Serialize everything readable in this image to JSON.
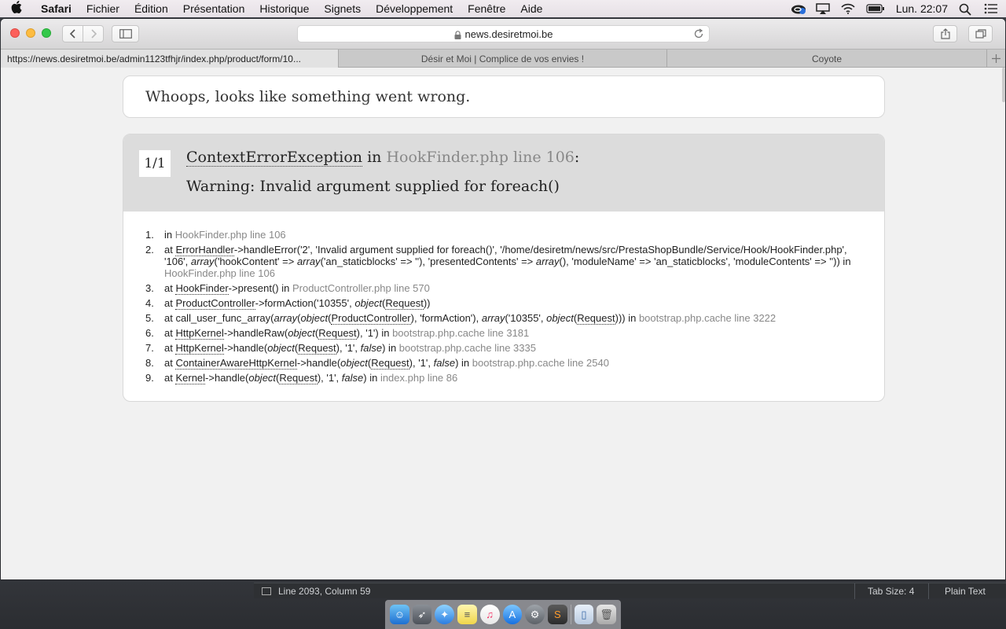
{
  "menubar": {
    "app": "Safari",
    "items": [
      "Fichier",
      "Édition",
      "Présentation",
      "Historique",
      "Signets",
      "Développement",
      "Fenêtre",
      "Aide"
    ],
    "clock": "Lun. 22:07"
  },
  "toolbar": {
    "address": "news.desiretmoi.be"
  },
  "tabs": [
    {
      "label": "https://news.desiretmoi.be/admin1123tfhjr/index.php/product/form/10..."
    },
    {
      "label": "Désir et Moi | Complice de vos envies !"
    },
    {
      "label": "Coyote"
    }
  ],
  "page": {
    "whoops": "Whoops, looks like something went wrong.",
    "counter": "1/1",
    "exception_class": "ContextErrorException",
    "in_word": "in",
    "exception_location": "HookFinder.php line 106",
    "colon": ":",
    "message": "Warning: Invalid argument supplied for foreach()",
    "trace": [
      {
        "n": "1.",
        "a": "in ",
        "loc": "HookFinder.php line 106"
      },
      {
        "n": "2.",
        "a": "at ",
        "cls": "ErrorHandler",
        "b": "->handleError('2', 'Invalid argument supplied for foreach()', '/home/desiretm/news/src/PrestaShopBundle/Service/Hook/HookFinder.php', '106', ",
        "arr1": "array",
        "c": "('hookContent' => ",
        "arr2": "array",
        "d": "('an_staticblocks' => ''), 'presentedContents' => ",
        "arr3": "array",
        "e": "(), 'moduleName' => 'an_staticblocks', 'moduleContents' => '')) in ",
        "loc": "HookFinder.php line 106"
      },
      {
        "n": "3.",
        "a": "at ",
        "cls": "HookFinder",
        "b": "->present() in ",
        "loc": "ProductController.php line 570"
      },
      {
        "n": "4.",
        "a": "at ",
        "cls": "ProductController",
        "b": "->formAction('10355', ",
        "obj": "object",
        "p": "(",
        "req": "Request",
        "q": "))"
      },
      {
        "n": "5.",
        "a": "at call_user_func_array(",
        "arr": "array",
        "p1": "(",
        "obj": "object",
        "p2": "(",
        "cls": "ProductController",
        "b": "), 'formAction'), ",
        "arr2": "array",
        "c": "('10355', ",
        "obj2": "object",
        "p3": "(",
        "req": "Request",
        "d": "))) in ",
        "loc": "bootstrap.php.cache line 3222"
      },
      {
        "n": "6.",
        "a": "at ",
        "cls": "HttpKernel",
        "b": "->handleRaw(",
        "obj": "object",
        "p": "(",
        "req": "Request",
        "c": "), '1') in ",
        "loc": "bootstrap.php.cache line 3181"
      },
      {
        "n": "7.",
        "a": "at ",
        "cls": "HttpKernel",
        "b": "->handle(",
        "obj": "object",
        "p": "(",
        "req": "Request",
        "c": "), '1', ",
        "f": "false",
        "d": ") in ",
        "loc": "bootstrap.php.cache line 3335"
      },
      {
        "n": "8.",
        "a": "at ",
        "cls": "ContainerAwareHttpKernel",
        "b": "->handle(",
        "obj": "object",
        "p": "(",
        "req": "Request",
        "c": "), '1', ",
        "f": "false",
        "d": ") in ",
        "loc": "bootstrap.php.cache line 2540"
      },
      {
        "n": "9.",
        "a": "at ",
        "cls": "Kernel",
        "b": "->handle(",
        "obj": "object",
        "p": "(",
        "req": "Request",
        "c": "), '1', ",
        "f": "false",
        "d": ") in ",
        "loc": "index.php line 86"
      }
    ]
  },
  "statusbar": {
    "position": "Line 2093, Column 59",
    "tab_size": "Tab Size: 4",
    "syntax": "Plain Text"
  },
  "colors": {
    "close": "#fc605b",
    "minimize": "#fdbc40",
    "maximize": "#34c84a",
    "header_bg": "#dcdcdc",
    "muted_text": "#888888"
  }
}
